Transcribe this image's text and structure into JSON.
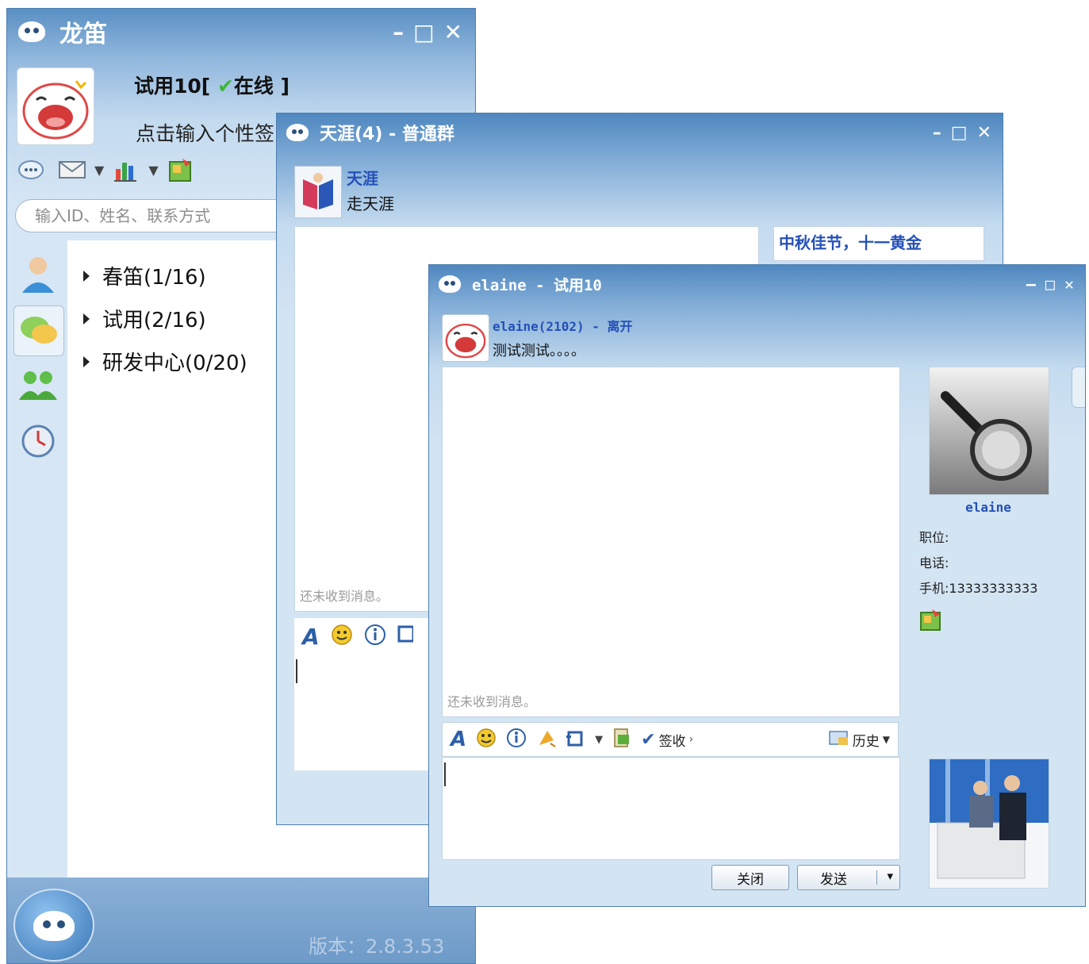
{
  "main_window": {
    "title": "龙笛",
    "controls": [
      "–",
      "□",
      "✕"
    ],
    "user_name": "试用10[",
    "user_status": "在线",
    "user_status_close": "]",
    "signature": "点击输入个性签",
    "search": {
      "placeholder": "输入ID、姓名、联系方式"
    },
    "groups": [
      {
        "label": "春笛(1/16)"
      },
      {
        "label": "试用(2/16)"
      },
      {
        "label": "研发中心(0/20)"
      }
    ],
    "version": "版本：2.8.3.53"
  },
  "group_window": {
    "title": "天涯(4) - 普通群",
    "controls": [
      "–",
      "□",
      "✕"
    ],
    "group_name": "天涯",
    "group_desc": "走天涯",
    "empty_message": "还未收到消息。",
    "notice": "中秋佳节，十一黄金"
  },
  "chat_window": {
    "title": "elaine - 试用10",
    "controls": [
      "–",
      "□",
      "✕"
    ],
    "contact_line": "elaine(2102) - 离开",
    "contact_desc": "测试测试。。。。",
    "empty_message": "还未收到消息。",
    "toolbar": {
      "sign_label": "签收",
      "history_label": "历史"
    },
    "close_button": "关闭",
    "send_button": "发送",
    "send_dropdown": "▾",
    "info": {
      "name": "elaine",
      "position": "职位:",
      "phone": "电话:",
      "mobile": "手机:13333333333"
    }
  },
  "colors": {
    "title_blue": "#4f87bf",
    "panel_blue": "#d3e4f3",
    "link_blue": "#2450b8",
    "online_green": "#3eb43a"
  },
  "icons": [
    "logo-icon",
    "chat-bubble-icon",
    "mail-icon",
    "chart-icon",
    "app-icon",
    "contacts-icon",
    "recent-chat-icon",
    "group-icon",
    "clock-icon",
    "font-icon",
    "smiley-icon",
    "info-icon",
    "shake-icon",
    "screenshot-icon",
    "file-icon",
    "check-icon",
    "history-icon"
  ]
}
